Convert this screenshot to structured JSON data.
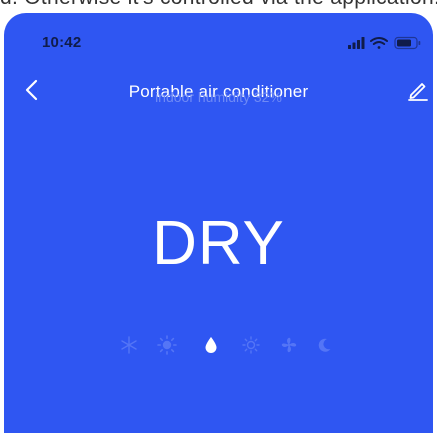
{
  "top_strip": {
    "text": "d. Otherwise it's controlled via the application."
  },
  "status_bar": {
    "time": "10:42",
    "icons": [
      "signal-icon",
      "wifi-icon",
      "battery-icon"
    ]
  },
  "header": {
    "back_icon": "chevron-left-icon",
    "title": "Portable air conditioner",
    "edit_icon": "pencil-icon"
  },
  "humidity_label": "indoor humidity 32%",
  "mode": {
    "current": "DRY",
    "options": [
      {
        "icon": "snowflake-icon",
        "active": false
      },
      {
        "icon": "sun-icon",
        "active": false
      },
      {
        "icon": "water-drop-icon",
        "active": true
      },
      {
        "icon": "auto-sun-icon",
        "active": false
      },
      {
        "icon": "fan-icon",
        "active": false
      },
      {
        "icon": "moon-icon",
        "active": false
      }
    ]
  },
  "colors": {
    "background": "#2f56f2",
    "text": "#ffffff",
    "muted": "#6e89f5",
    "inactive_icon": "#5475f6",
    "status_text": "#101c4a"
  }
}
